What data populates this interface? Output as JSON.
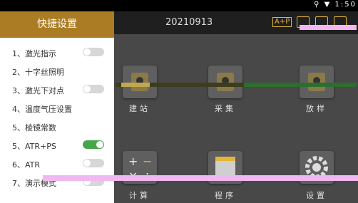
{
  "status": {
    "time_partial": "1:50"
  },
  "sidebar": {
    "title": "快捷设置",
    "items": [
      {
        "label": "1、激光指示",
        "toggle": false
      },
      {
        "label": "2、十字丝照明"
      },
      {
        "label": "3、激光下对点",
        "toggle": false
      },
      {
        "label": "4、温度气压设置"
      },
      {
        "label": "5、棱镜常数"
      },
      {
        "label": "5、ATR+PS",
        "toggle": true
      },
      {
        "label": "6、ATR",
        "toggle": false
      },
      {
        "label": "7、演示模式",
        "toggle": false
      }
    ]
  },
  "topbar": {
    "title": "20210913",
    "aplus": "A+P"
  },
  "tiles": [
    {
      "label": "建站"
    },
    {
      "label": "采集"
    },
    {
      "label": "放样"
    },
    {
      "label": "计算"
    },
    {
      "label": "程序"
    },
    {
      "label": "设置"
    }
  ],
  "colors": {
    "accent": "#ab7c24",
    "toggle_on": "#47a64a",
    "topbar_accent": "#e5b53a"
  }
}
